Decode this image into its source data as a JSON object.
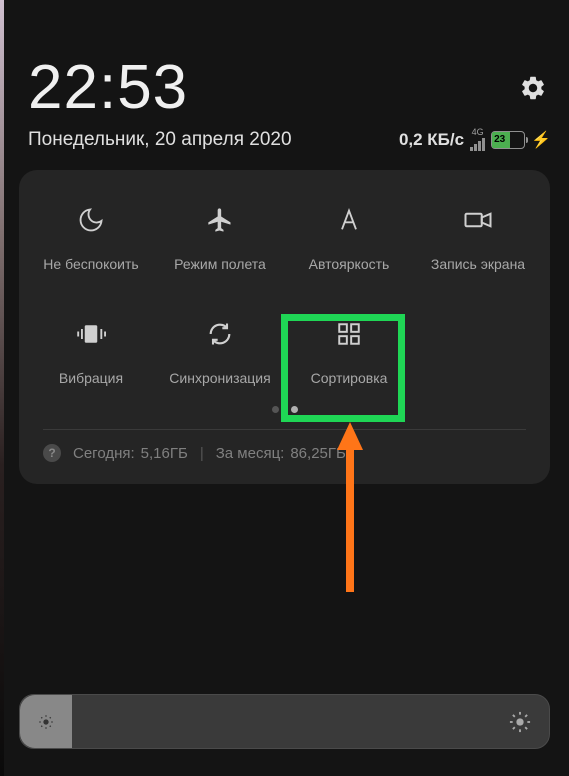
{
  "status": {
    "time": "22:53",
    "date": "Понедельник, 20 апреля 2020",
    "speed": "0,2 КБ/с",
    "network": "4G",
    "battery_percent": "23"
  },
  "tiles": {
    "dnd": "Не беспокоить",
    "airplane": "Режим полета",
    "autobright": "Автояркость",
    "record": "Запись экрана",
    "vibration": "Вибрация",
    "sync": "Синхронизация",
    "sort": "Сортировка"
  },
  "usage": {
    "today_label": "Сегодня:",
    "today_value": "5,16ГБ",
    "month_label": "За месяц:",
    "month_value": "86,25ГБ"
  }
}
